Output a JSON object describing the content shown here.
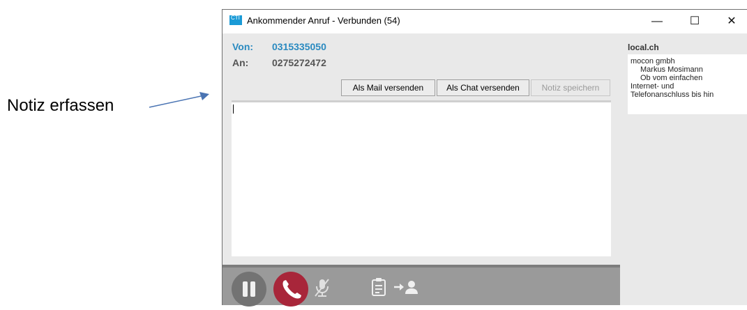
{
  "annotation": {
    "text": "Notiz erfassen"
  },
  "window": {
    "title": "Ankommender Anruf - Verbunden (54)",
    "app_icon_text": "CTI",
    "minimize": "—",
    "maximize": "☐",
    "close": "✕"
  },
  "call": {
    "von_label": "Von:",
    "von_value": "0315335050",
    "an_label": "An:",
    "an_value": "0275272472"
  },
  "actions": {
    "mail_label": "Als Mail versenden",
    "chat_label": "Als Chat versenden",
    "save_label": "Notiz speichern"
  },
  "note": {
    "value": ""
  },
  "sidebar": {
    "title": "local.ch",
    "lines": [
      "mocon gmbh",
      "Markus Mosimann",
      "Ob vom einfachen",
      "Internet- und",
      "Telefonanschluss bis hin"
    ]
  },
  "toolbar": {
    "icons": [
      "pause-icon",
      "hangup-icon",
      "mute-icon",
      "notes-icon",
      "transfer-icon"
    ]
  },
  "colors": {
    "accent_blue": "#2a8ac0",
    "hangup_red": "#a8263a",
    "toolbar_gray": "#9a9a9a"
  }
}
